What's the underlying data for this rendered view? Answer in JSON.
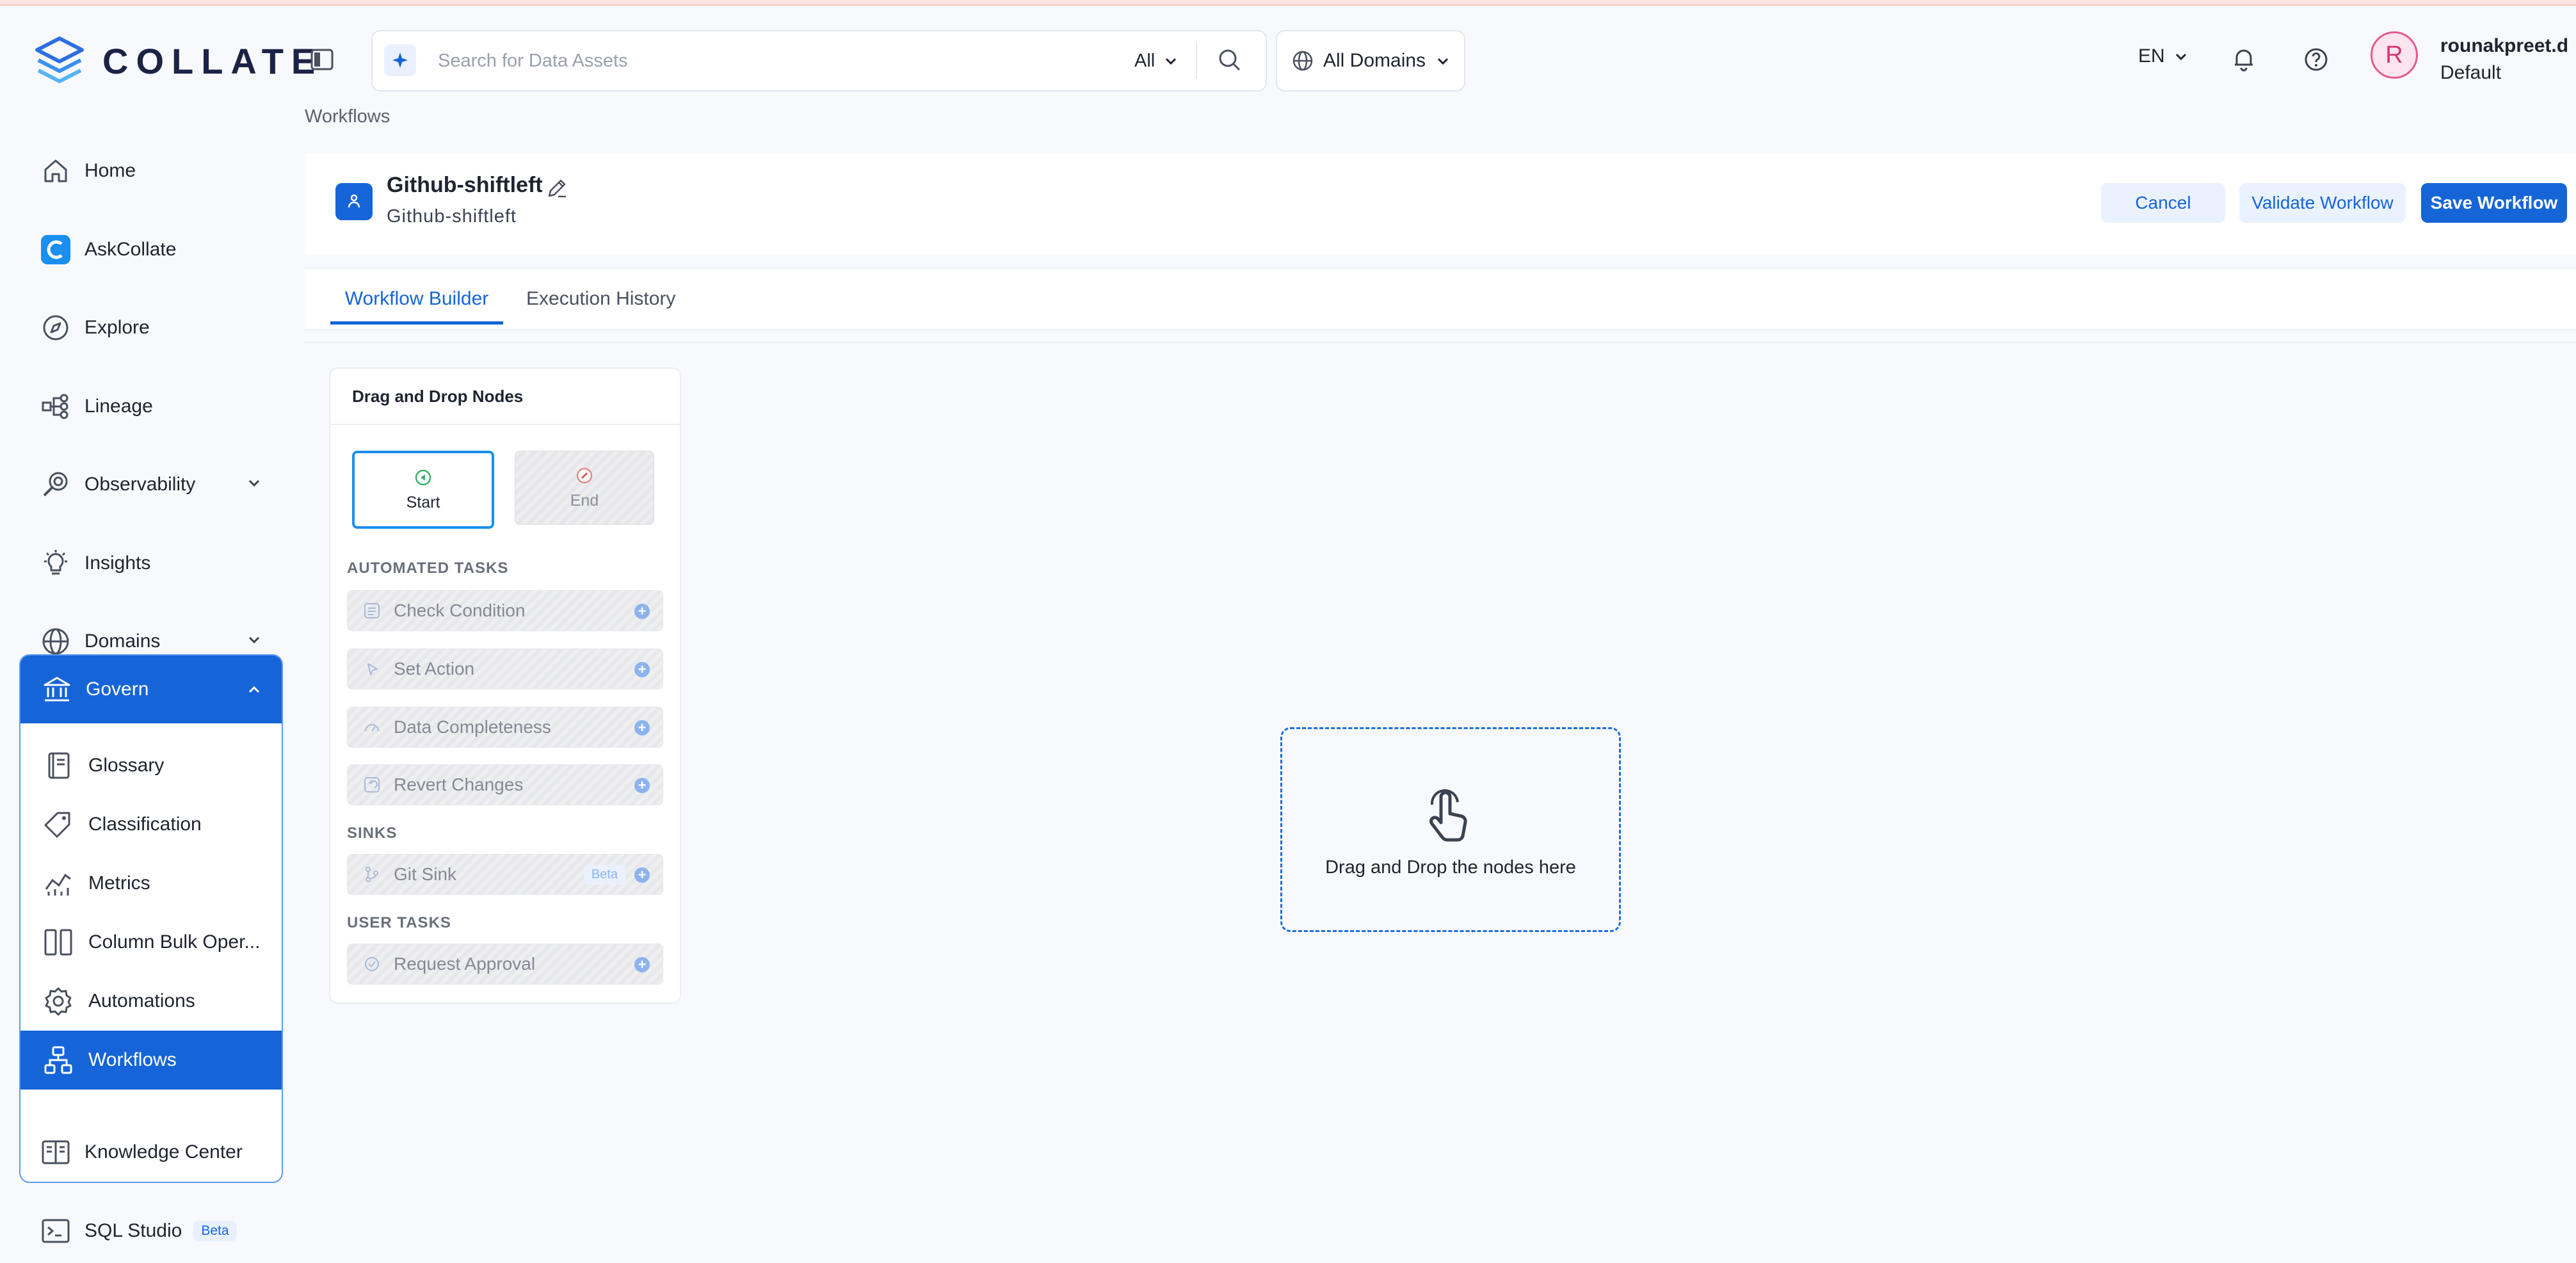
{
  "app": {
    "logo_text": "COLLATE"
  },
  "header": {
    "search_placeholder": "Search for Data Assets",
    "search_filter": "All",
    "domains_label": "All Domains",
    "language": "EN",
    "user": {
      "initial": "R",
      "name": "rounakpreet.d",
      "role": "Default"
    }
  },
  "sidebar": {
    "items": [
      {
        "label": "Home"
      },
      {
        "label": "AskCollate"
      },
      {
        "label": "Explore"
      },
      {
        "label": "Lineage"
      },
      {
        "label": "Observability"
      },
      {
        "label": "Insights"
      },
      {
        "label": "Domains"
      }
    ],
    "govern": {
      "label": "Govern",
      "items": [
        {
          "label": "Glossary"
        },
        {
          "label": "Classification"
        },
        {
          "label": "Metrics"
        },
        {
          "label": "Column Bulk Oper..."
        },
        {
          "label": "Automations"
        },
        {
          "label": "Workflows"
        }
      ]
    },
    "bottom_items": [
      {
        "label": "Knowledge Center"
      },
      {
        "label": "SQL Studio",
        "badge": "Beta"
      }
    ]
  },
  "breadcrumb": "Workflows",
  "workflow": {
    "title": "Github-shiftleft",
    "subtitle": "Github-shiftleft",
    "buttons": {
      "cancel": "Cancel",
      "validate": "Validate Workflow",
      "save": "Save Workflow"
    }
  },
  "tabs": [
    {
      "label": "Workflow Builder",
      "active": true
    },
    {
      "label": "Execution History"
    }
  ],
  "palette": {
    "title": "Drag and Drop Nodes",
    "start": "Start",
    "end": "End",
    "sections": {
      "automated": "AUTOMATED TASKS",
      "sinks": "SINKS",
      "user": "USER TASKS"
    },
    "automated_tasks": [
      {
        "label": "Check Condition"
      },
      {
        "label": "Set Action"
      },
      {
        "label": "Data Completeness"
      },
      {
        "label": "Revert Changes"
      }
    ],
    "sinks": [
      {
        "label": "Git Sink",
        "badge": "Beta"
      }
    ],
    "user_tasks": [
      {
        "label": "Request Approval"
      }
    ]
  },
  "canvas": {
    "drop_text": "Drag and Drop the nodes here"
  },
  "colors": {
    "primary": "#1565d8",
    "accent_light": "#eaf2ff",
    "avatar_ring": "#e25a91"
  }
}
